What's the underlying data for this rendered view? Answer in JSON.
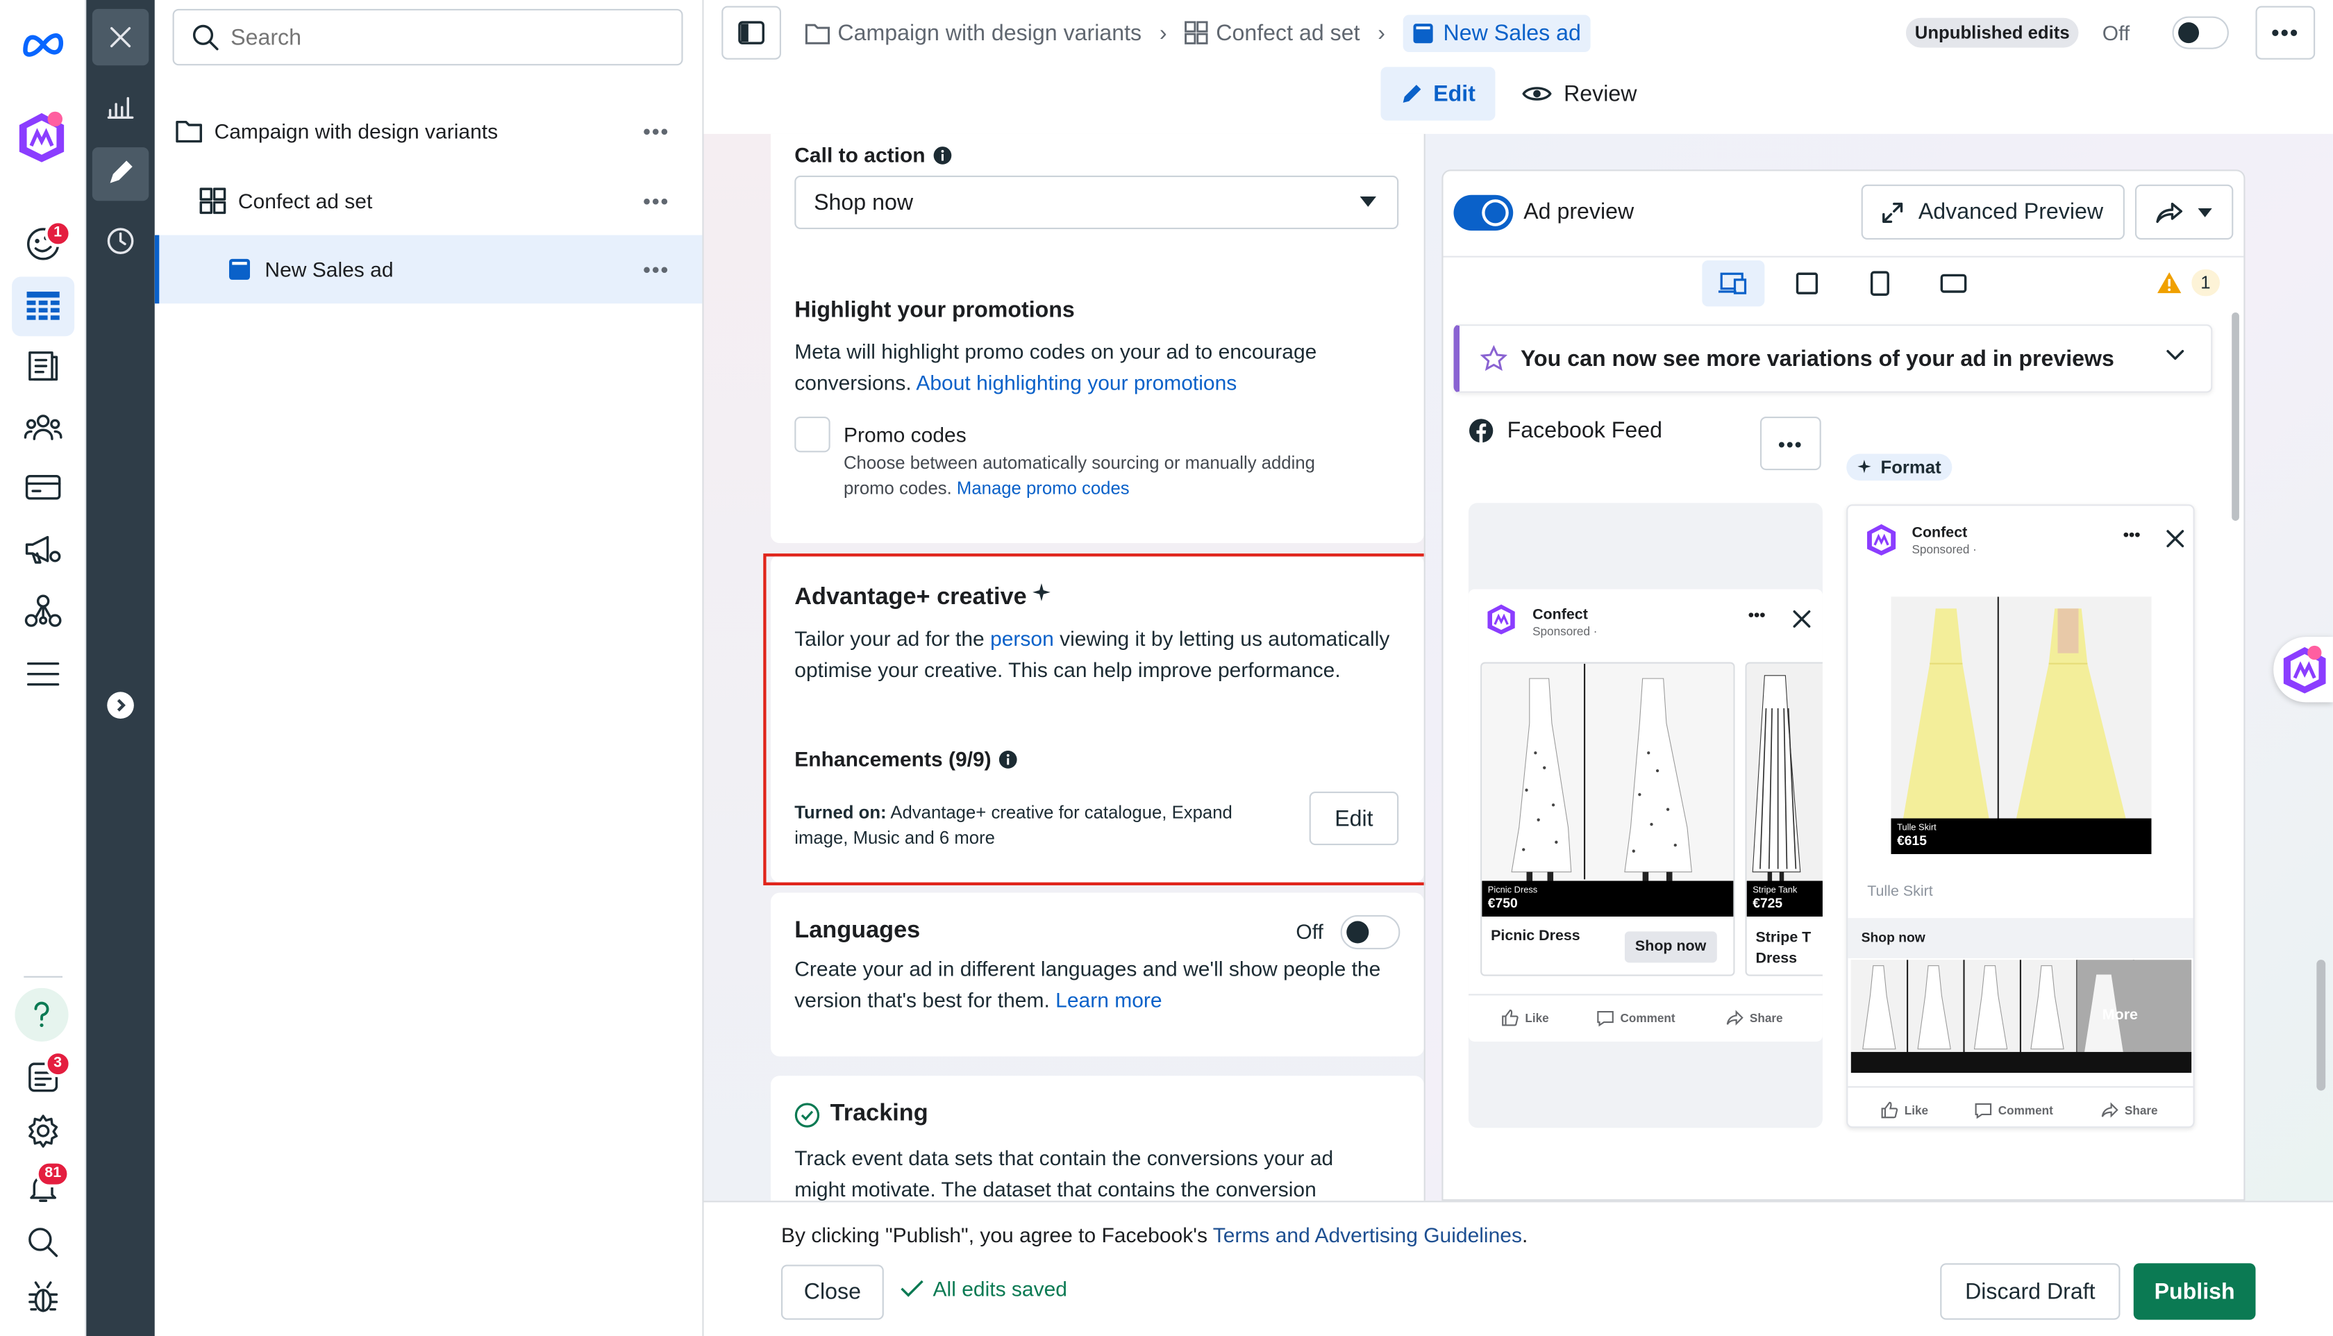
{
  "search": {
    "placeholder": "Search"
  },
  "left_nav": {
    "badges": {
      "business": "1",
      "notifications_1": "3",
      "notifications_2": "81"
    }
  },
  "tree": {
    "campaign": "Campaign with design variants",
    "adset": "Confect ad set",
    "ad": "New Sales ad"
  },
  "breadcrumb": {
    "campaign": "Campaign with design variants",
    "adset": "Confect ad set",
    "ad": "New Sales ad"
  },
  "header": {
    "status": "Unpublished edits",
    "toggle_label": "Off",
    "edit_tab": "Edit",
    "review_tab": "Review"
  },
  "cta": {
    "label": "Call to action",
    "value": "Shop now"
  },
  "promotions": {
    "title": "Highlight your promotions",
    "body": "Meta will highlight promo codes on your ad to encourage conversions.",
    "link": "About highlighting your promotions",
    "checkbox_label": "Promo codes",
    "checkbox_desc": "Choose between automatically sourcing or manually adding promo codes.",
    "checkbox_link": "Manage promo codes"
  },
  "advantage": {
    "title": "Advantage+ creative",
    "body_pre": "Tailor your ad for the ",
    "body_link": "person",
    "body_post": " viewing it by letting us automatically optimise your creative. This can help improve performance.",
    "enh_label": "Enhancements (9/9)",
    "turned_on_label": "Turned on:",
    "turned_on_text": " Advantage+ creative for catalogue, Expand image, Music and 6 more",
    "edit_btn": "Edit"
  },
  "languages": {
    "title": "Languages",
    "toggle_label": "Off",
    "body": "Create your ad in different languages and we'll show people the version that's best for them.",
    "link": "Learn more"
  },
  "tracking": {
    "title": "Tracking",
    "body": "Track event data sets that contain the conversions your ad might motivate. The dataset that contains the conversion"
  },
  "preview": {
    "toggle_label": "Ad preview",
    "advanced_btn": "Advanced Preview",
    "warning_count": "1",
    "banner": "You can now see more variations of your ad in previews",
    "placement": "Facebook Feed",
    "format_label": "Format"
  },
  "ad1": {
    "brand": "Confect",
    "sponsored": "Sponsored · ",
    "items": [
      {
        "name": "Picnic Dress",
        "tag": "Picnic Dress",
        "price": "€750"
      },
      {
        "name": "Stripe T Dress",
        "tag": "Stripe Tank",
        "price": "€725"
      }
    ],
    "cta": "Shop now",
    "like": "Like",
    "comment": "Comment",
    "share": "Share"
  },
  "ad2": {
    "brand": "Confect",
    "sponsored": "Sponsored · ",
    "tag": "Tulle Skirt",
    "price": "€615",
    "caption": "Tulle Skirt",
    "cta": "Shop now",
    "more": "More",
    "like": "Like",
    "comment": "Comment",
    "share": "Share"
  },
  "footer": {
    "notice_pre": "By clicking \"Publish\", you agree to Facebook's ",
    "notice_link": "Terms and Advertising Guidelines",
    "notice_post": ".",
    "close_btn": "Close",
    "saved": "All edits saved",
    "discard_btn": "Discard Draft",
    "publish_btn": "Publish"
  },
  "colors": {
    "accent": "#0a61c9",
    "publish": "#0b7a53",
    "highlight_border": "#e0241a",
    "sidebar_dark": "#2f3d48"
  }
}
